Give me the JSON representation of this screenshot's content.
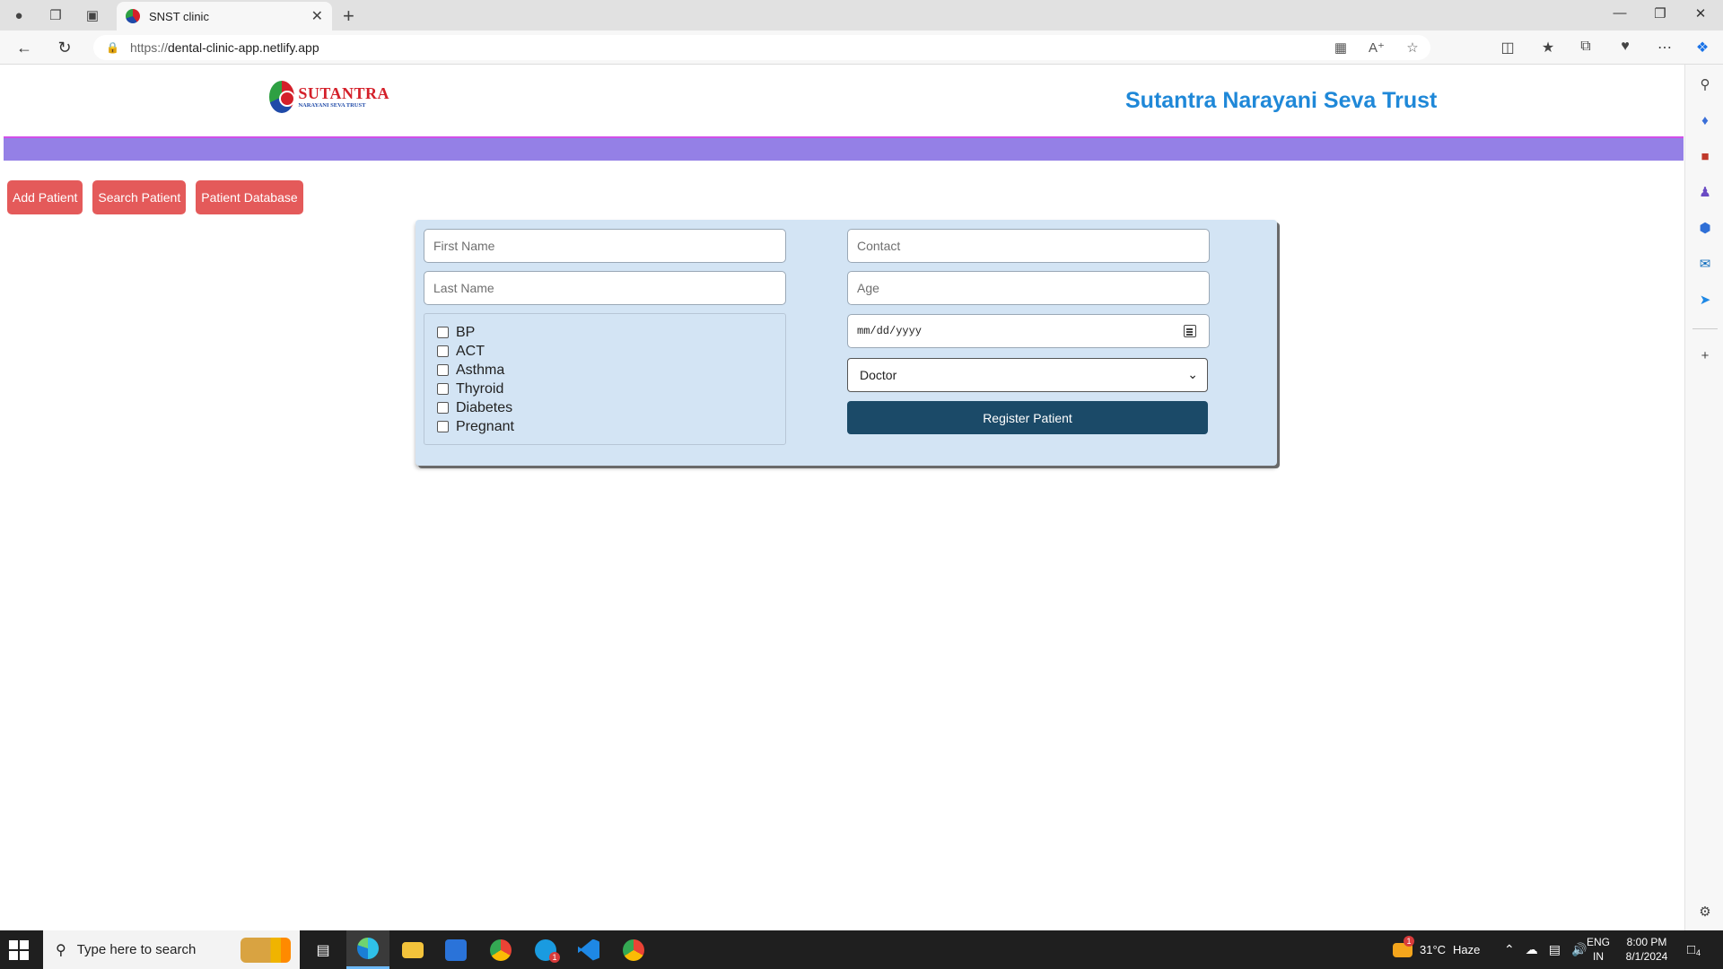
{
  "browser": {
    "tab_title": "SNST clinic",
    "url_protocol": "https://",
    "url_host": "dental-clinic-app.netlify.app"
  },
  "site": {
    "logo_main": "SUTANTRA",
    "logo_sub": "NARAYANI SEVA TRUST",
    "trust_title": "Sutantra Narayani Seva Trust"
  },
  "nav_buttons": [
    "Add Patient",
    "Search Patient",
    "Patient Database"
  ],
  "form": {
    "first_name_placeholder": "First Name",
    "last_name_placeholder": "Last Name",
    "contact_placeholder": "Contact",
    "age_placeholder": "Age",
    "date_placeholder": "mm/dd/yyyy",
    "doctor_selected": "Doctor",
    "conditions": [
      "BP",
      "ACT",
      "Asthma",
      "Thyroid",
      "Diabetes",
      "Pregnant"
    ],
    "register_label": "Register Patient"
  },
  "taskbar": {
    "search_placeholder": "Type here to search",
    "weather_temp": "31°C",
    "weather_text": "Haze",
    "weather_badge": "1",
    "lang_top": "ENG",
    "lang_bottom": "IN",
    "time": "8:00 PM",
    "date": "8/1/2024",
    "notification_count": "4",
    "skype_badge": "1"
  },
  "colors": {
    "brand_red": "#e45a5a",
    "nav_strip": "#9480e6",
    "title_blue": "#1f88d8",
    "form_bg": "#d3e4f4",
    "register_bg": "#1b4a68"
  }
}
